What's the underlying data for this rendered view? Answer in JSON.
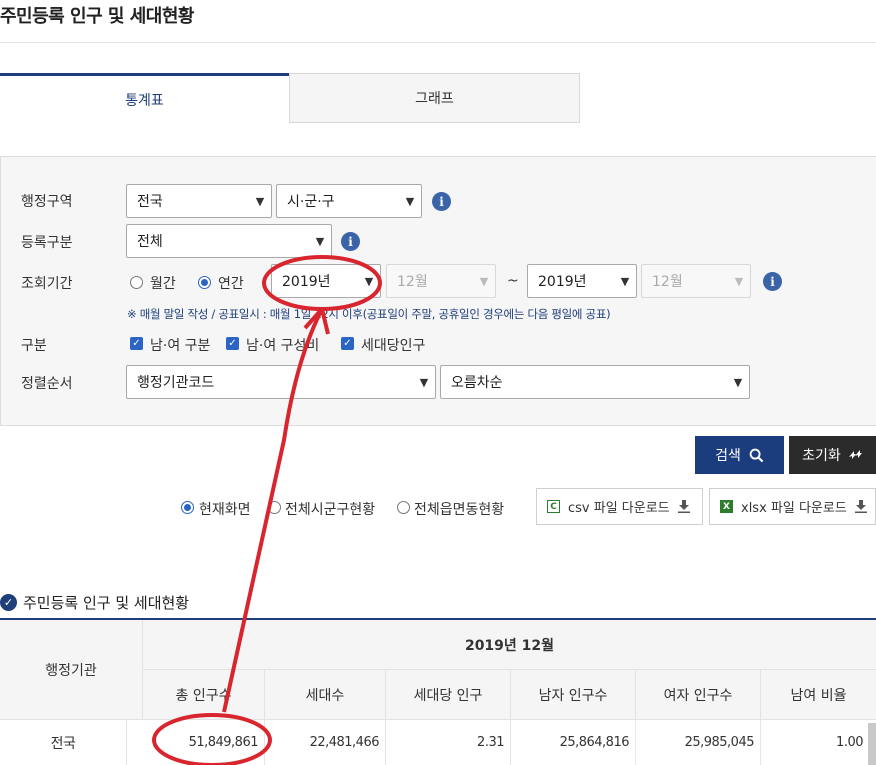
{
  "page": {
    "title": "주민등록 인구 및 세대현황"
  },
  "tabs": [
    {
      "label": "통계표"
    },
    {
      "label": "그래프"
    }
  ],
  "filters": {
    "region": {
      "label": "행정구역",
      "sido": "전국",
      "sigungu": "시·군·구"
    },
    "registration": {
      "label": "등록구분",
      "value": "전체"
    },
    "period": {
      "label": "조회기간",
      "monthly_label": "월간",
      "yearly_label": "연간",
      "selected": "yearly",
      "start_year": "2019년",
      "start_month": "12월",
      "separator": "~",
      "end_year": "2019년",
      "end_month": "12월",
      "note": "※ 매월 말일 작성 / 공표일시 : 매월 1일 12시 이후(공표일이 주말, 공휴일인 경우에는 다음 평일에 공표)"
    },
    "category": {
      "label": "구분",
      "options": [
        {
          "label": "남·여 구분",
          "checked": true
        },
        {
          "label": "남·여 구성비",
          "checked": true
        },
        {
          "label": "세대당인구",
          "checked": true
        }
      ]
    },
    "sort": {
      "label": "정렬순서",
      "field": "행정기관코드",
      "order": "오름차순"
    }
  },
  "actions": {
    "search": "검색",
    "reset": "초기화"
  },
  "view_options": [
    {
      "label": "현재화면",
      "selected": true
    },
    {
      "label": "전체시군구현황",
      "selected": false
    },
    {
      "label": "전체읍면동현황",
      "selected": false
    }
  ],
  "downloads": {
    "csv": "csv 파일 다운로드",
    "xlsx": "xlsx 파일 다운로드",
    "csv_badge": "C",
    "xlsx_badge": "X"
  },
  "section": {
    "title": "주민등록 인구 및 세대현황"
  },
  "table": {
    "org_header": "행정기관",
    "period_header": "2019년 12월",
    "columns": [
      "총 인구수",
      "세대수",
      "세대당 인구",
      "남자 인구수",
      "여자 인구수",
      "남여 비율"
    ],
    "rows": [
      {
        "org": "전국",
        "values": [
          "51,849,861",
          "22,481,466",
          "2.31",
          "25,864,816",
          "25,985,045",
          "1.00"
        ]
      }
    ]
  },
  "colors": {
    "accent": "#1f3f7a",
    "annotation": "#d8252e",
    "checkbox": "#2a64c5",
    "info": "#3a63a8"
  }
}
